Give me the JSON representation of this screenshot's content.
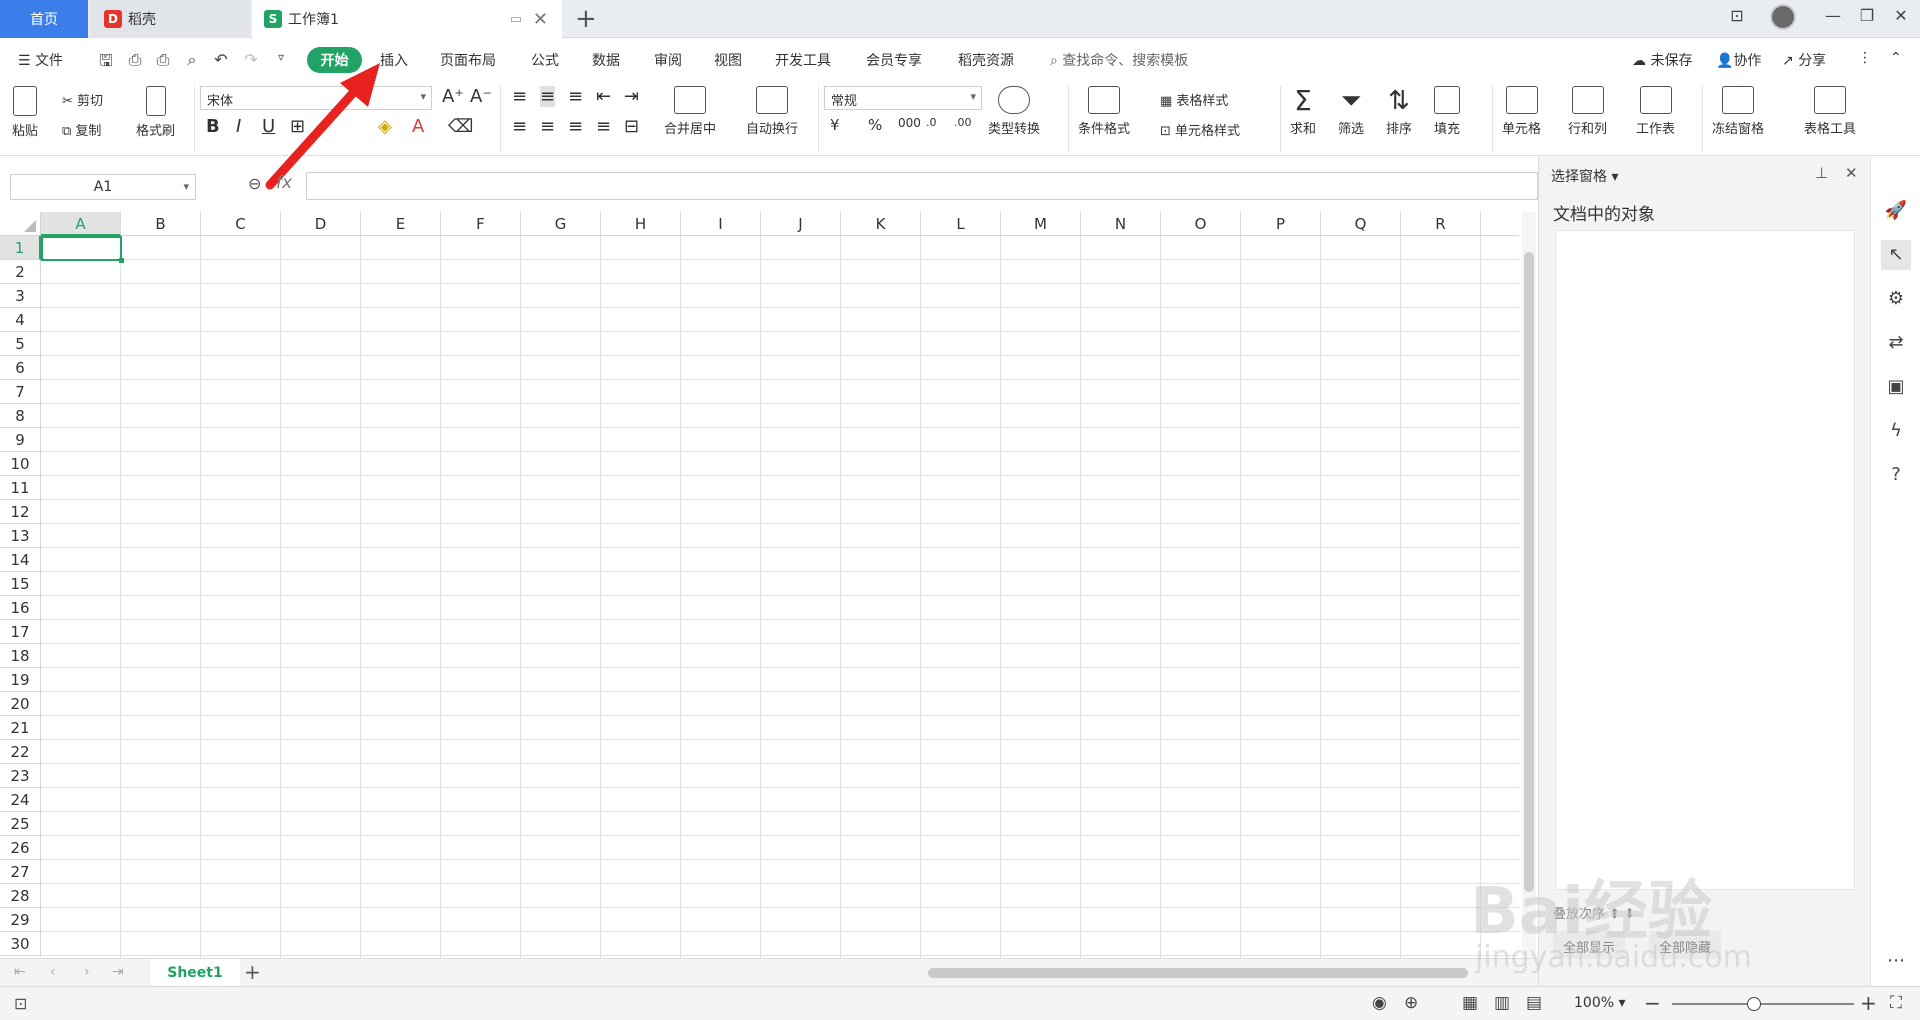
{
  "tabs": {
    "home": "首页",
    "docer": "稻壳",
    "workbook": "工作簿1"
  },
  "quick_access": {
    "file": "文件"
  },
  "menu": {
    "start": "开始",
    "items": [
      "插入",
      "页面布局",
      "公式",
      "数据",
      "审阅",
      "视图",
      "开发工具",
      "会员专享",
      "稻壳资源"
    ],
    "search": "查找命令、搜索模板",
    "unsaved": "未保存",
    "collab": "协作",
    "share": "分享"
  },
  "ribbon": {
    "paste": "粘贴",
    "cut": "剪切",
    "copy": "复制",
    "format_painter": "格式刷",
    "font_name": "宋体",
    "merge_center": "合并居中",
    "wrap_text": "自动换行",
    "number_format": "常规",
    "type_convert": "类型转换",
    "cond_format": "条件格式",
    "table_style": "表格样式",
    "cell_style": "单元格样式",
    "sum": "求和",
    "filter": "筛选",
    "sort": "排序",
    "fill": "填充",
    "cell": "单元格",
    "row_col": "行和列",
    "worksheet": "工作表",
    "freeze": "冻结窗格",
    "table_tools": "表格工具"
  },
  "formula_bar": {
    "name_box": "A1",
    "fx": "fx"
  },
  "columns": [
    "A",
    "B",
    "C",
    "D",
    "E",
    "F",
    "G",
    "H",
    "I",
    "J",
    "K",
    "L",
    "M",
    "N",
    "O",
    "P",
    "Q",
    "R"
  ],
  "rows": [
    "1",
    "2",
    "3",
    "4",
    "5",
    "6",
    "7",
    "8",
    "9",
    "10",
    "11",
    "12",
    "13",
    "14",
    "15",
    "16",
    "17",
    "18",
    "19",
    "20",
    "21",
    "22",
    "23",
    "24",
    "25",
    "26",
    "27",
    "28",
    "29",
    "30"
  ],
  "sheet_tab": "Sheet1",
  "status": {
    "zoom": "100%"
  },
  "selection_pane": {
    "title": "选择窗格",
    "subtitle": "文档中的对象",
    "order": "叠放次序",
    "show_all": "全部显示",
    "hide_all": "全部隐藏"
  },
  "watermark": {
    "brand": "Bai经验",
    "url": "jingyan.baidu.com"
  },
  "colors": {
    "accent": "#21a366",
    "tab_blue": "#3b7de9",
    "arrow": "#e8231f"
  }
}
